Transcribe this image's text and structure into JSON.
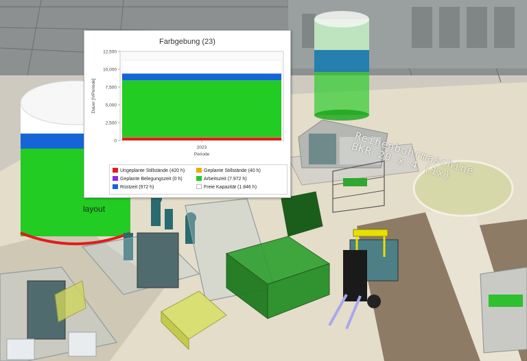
{
  "scene": {
    "layout_label": "layout",
    "machine_label_line1": "Reihenbohrmaschine",
    "machine_label_line2": "BKR 20 x 4 (1x)"
  },
  "colors": {
    "unplanned": "#e01d1d",
    "planned": "#f5a600",
    "occupancy": "#8a2be2",
    "work": "#22cc22",
    "setup": "#1565d8",
    "free": "#ffffff"
  },
  "chart_data": {
    "type": "bar",
    "title": "Farbgebung (23)",
    "xlabel": "Periode",
    "ylabel": "Dauer [h/Periode]",
    "ylim": [
      0,
      12500
    ],
    "yticks": [
      "0",
      "2,500",
      "5,000",
      "7,500",
      "10,000",
      "12,500"
    ],
    "categories": [
      "2023"
    ],
    "stacked": true,
    "series": [
      {
        "name": "Ungeplante Stillstände (420 h)",
        "values": [
          420
        ],
        "color": "#e01d1d"
      },
      {
        "name": "Geplante Stillstände (40 h)",
        "values": [
          40
        ],
        "color": "#f5a600"
      },
      {
        "name": "Geplante Belegungszeit (0 h)",
        "values": [
          0
        ],
        "color": "#8a2be2"
      },
      {
        "name": "Arbeitszeit (7.972 h)",
        "values": [
          7972
        ],
        "color": "#22cc22"
      },
      {
        "name": "Rüstzeit (972 h)",
        "values": [
          972
        ],
        "color": "#1565d8"
      },
      {
        "name": "Freie Kapazität (1.846 h)",
        "values": [
          1846
        ],
        "color": "#ffffff"
      }
    ],
    "legend_position": "bottom",
    "grid": false
  }
}
